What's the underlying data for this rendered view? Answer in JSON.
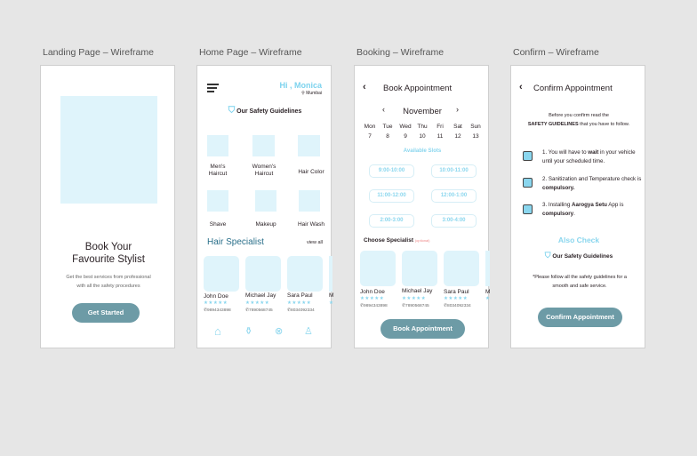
{
  "frames": {
    "landing": "Landing Page – Wireframe",
    "home": "Home Page – Wireframe",
    "booking": "Booking – Wireframe",
    "confirm": "Confirm – Wireframe"
  },
  "colors": {
    "accent": "#7dd3ee",
    "button": "#6d9ba6",
    "placeholder": "#dff4fb",
    "heading": "#2a6f8a"
  },
  "landing": {
    "title_line1": "Book Your",
    "title_line2": "Favourite Stylist",
    "subtitle_line1": "Get the best services from professional",
    "subtitle_line2": "with all the safety procedures",
    "cta": "Get Started"
  },
  "home": {
    "greeting": "Hi , Monica",
    "location": "Mumbai",
    "safety": "Our Safety Guidelines",
    "services": [
      "Men's Haircut",
      "Women's Haircut",
      "Hair Color",
      "Shave",
      "Makeup",
      "Hair Wash"
    ],
    "section_title": "Hair Specialist",
    "view_all": "view all",
    "specialists": [
      {
        "name": "John Doe",
        "stars": "★★★★★",
        "phone": "9894343898"
      },
      {
        "name": "Michael Jay",
        "stars": "★★★★★",
        "phone": "7890568745"
      },
      {
        "name": "Sara Paul",
        "stars": "★★★★★",
        "phone": "8034092334"
      },
      {
        "name": "M",
        "stars": "★",
        "phone": ""
      }
    ],
    "nav": [
      "home-icon",
      "products-icon",
      "offers-icon",
      "profile-icon"
    ]
  },
  "booking": {
    "title": "Book Appointment",
    "month": "November",
    "days": [
      "Mon",
      "Tue",
      "Wed",
      "Thu",
      "Fri",
      "Sat",
      "Sun"
    ],
    "dates": [
      "7",
      "8",
      "9",
      "10",
      "11",
      "12",
      "13"
    ],
    "slots_title": "Available Slots",
    "slots": [
      "9:00-10:00",
      "10:00-11:00",
      "11:00-12:00",
      "12:00-1:00",
      "2:00-3:00",
      "3:00-4:00"
    ],
    "choose": "Choose Specialist",
    "optional": "(optional)",
    "specialists": [
      {
        "name": "John Doe",
        "stars": "★★★★★",
        "phone": "9894343898"
      },
      {
        "name": "Michael Jay",
        "stars": "★★★★★",
        "phone": "7890568745"
      },
      {
        "name": "Sara Paul",
        "stars": "★★★★★",
        "phone": "8034092334"
      },
      {
        "name": "M",
        "stars": "★",
        "phone": ""
      }
    ],
    "cta": "Book Appointment"
  },
  "confirm": {
    "title": "Confirm Appointment",
    "intro_line1": "Before you confirm read  the",
    "intro_bold": "SAFETY GUIDELINES",
    "intro_rest": " that you have to follow.",
    "items": [
      {
        "a": "1. You will have to ",
        "b": "wait",
        "c": " in your vehicle until your scheduled time."
      },
      {
        "a": "2. Sanitization and Temperature check is ",
        "b": "compulsory.",
        "c": ""
      },
      {
        "a": "3. Installing ",
        "b": "Aarogya Setu",
        "c": " App is ",
        "d": "compulsory",
        "e": "."
      }
    ],
    "also": "Also Check",
    "safety": "Our Safety Guidelines",
    "note": "*Please follow all the safety guidelines for a smooth and safe service.",
    "cta": "Confirm Appointment"
  }
}
